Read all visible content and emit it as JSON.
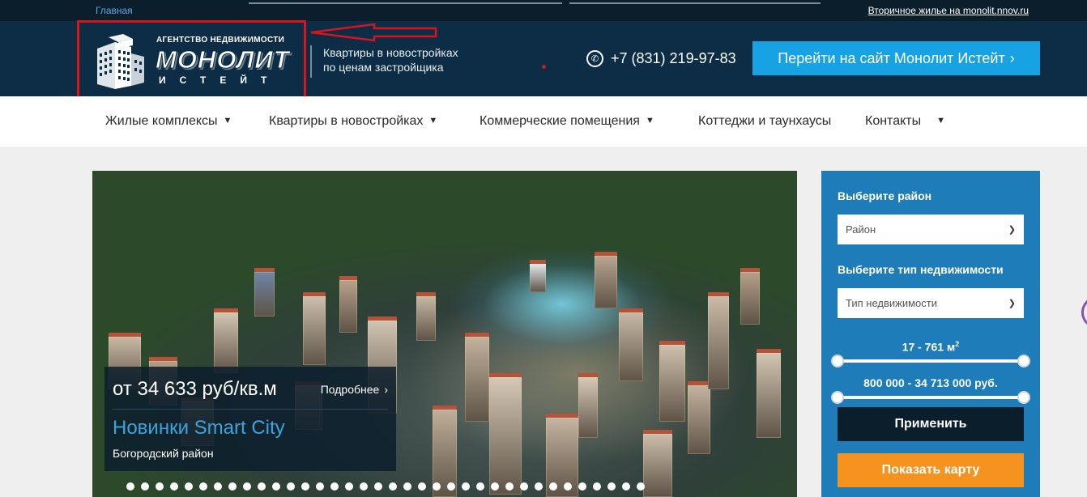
{
  "topbar": {
    "home_link": "Главная",
    "secondary_link": "Вторичное жилье на monolit.nnov.ru"
  },
  "header": {
    "logo": {
      "agency": "АГЕНТСТВО НЕДВИЖИМОСТИ",
      "brand": "МОНОЛИТ",
      "brand_sub": "ИСТЕЙТ"
    },
    "tagline_line1": "Квартиры в новостройках",
    "tagline_line2": "по ценам застройщика",
    "phone": "+7 (831) 219-97-83",
    "site_button": "Перейти на сайт Монолит Истейт"
  },
  "nav": {
    "items": [
      {
        "label": "Жилые комплексы",
        "dropdown": true
      },
      {
        "label": "Квартиры в новостройках",
        "dropdown": true
      },
      {
        "label": "Коммерческие помещения",
        "dropdown": true
      },
      {
        "label": "Коттеджи и таунхаусы",
        "dropdown": false
      },
      {
        "label": "Контакты",
        "dropdown": true
      }
    ]
  },
  "hero": {
    "price": "от 34 633 руб/кв.м",
    "more_label": "Подробнее",
    "title": "Новинки Smart City",
    "district": "Богородский район",
    "slide_count": 36
  },
  "filter": {
    "district_label": "Выберите район",
    "district_select": "Район",
    "type_label": "Выберите тип недвижимости",
    "type_select": "Тип недвижимости",
    "area_range": "17 - 761 м",
    "area_unit_sup": "2",
    "price_range": "800 000 - 34 713 000 руб.",
    "apply_button": "Применить",
    "map_button": "Показать карту"
  },
  "colors": {
    "header_bg": "#0c2d45",
    "accent_blue": "#17a3e3",
    "panel_blue": "#1e7db8",
    "orange": "#f6921e",
    "annotation_red": "#d9141b"
  }
}
